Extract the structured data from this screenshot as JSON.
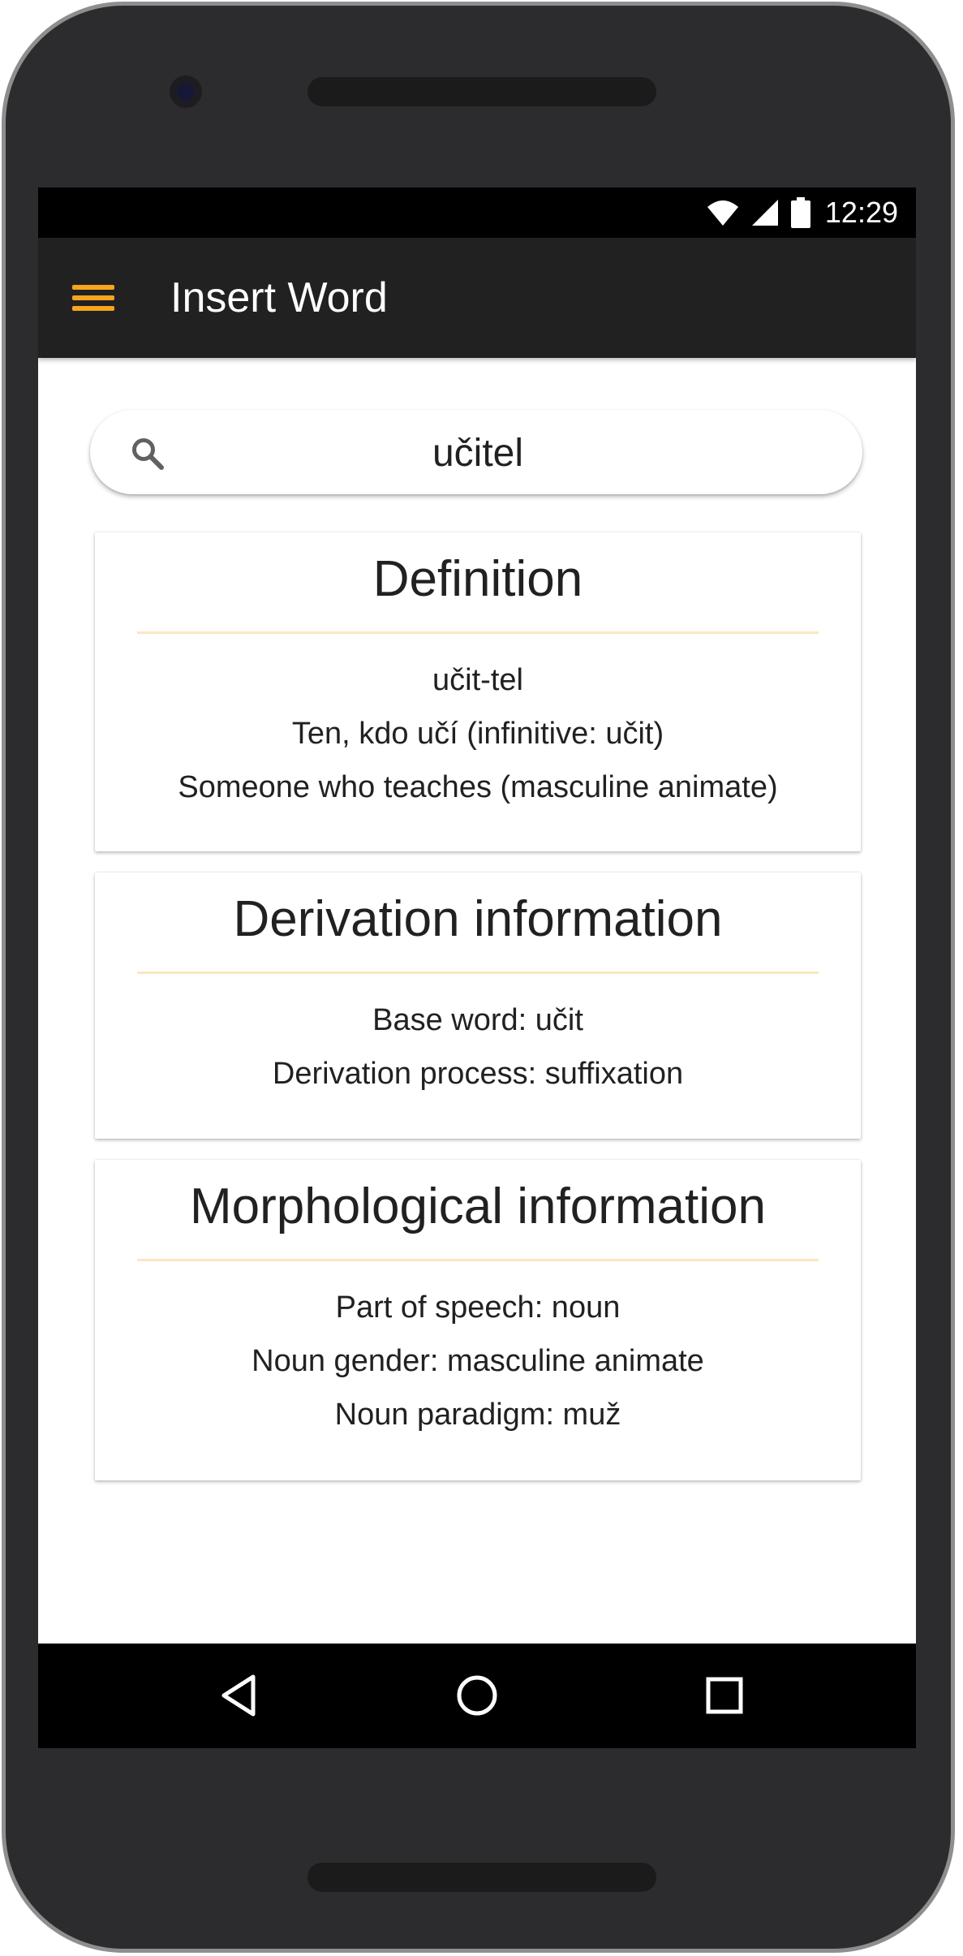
{
  "status_bar": {
    "time": "12:29",
    "icons": [
      "wifi-icon",
      "cellular-signal-icon",
      "battery-icon"
    ]
  },
  "app_bar": {
    "menu_icon": "hamburger-menu-icon",
    "title": "Insert Word"
  },
  "search": {
    "icon": "search-icon",
    "value": "učitel"
  },
  "cards": [
    {
      "title": "Definition",
      "lines": [
        "učit-tel",
        "Ten, kdo učí (infinitive: učit)",
        "Someone who teaches (masculine animate)"
      ]
    },
    {
      "title": "Derivation information",
      "lines": [
        "Base word: učit",
        "Derivation process: suffixation"
      ]
    },
    {
      "title": "Morphological information",
      "lines": [
        "Part of speech: noun",
        "Noun gender: masculine animate",
        "Noun paradigm: muž"
      ]
    }
  ],
  "nav_bar": {
    "buttons": [
      "back-icon",
      "home-icon",
      "recents-icon"
    ]
  },
  "colors": {
    "accent": "#f5a51e",
    "app_bar": "#212121",
    "divider": "#fbe7bf",
    "device_body": "#2c2b2d"
  }
}
